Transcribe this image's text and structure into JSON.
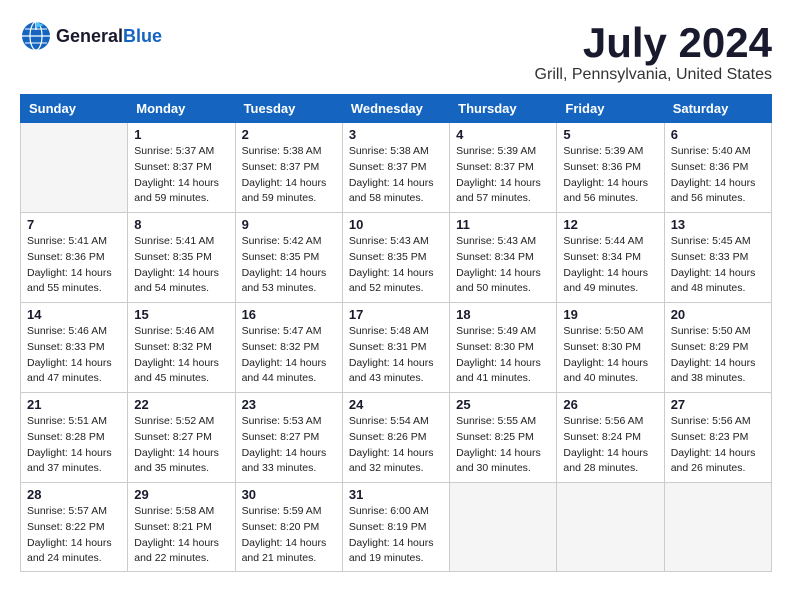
{
  "header": {
    "logo_general": "General",
    "logo_blue": "Blue",
    "month_year": "July 2024",
    "location": "Grill, Pennsylvania, United States"
  },
  "days_of_week": [
    "Sunday",
    "Monday",
    "Tuesday",
    "Wednesday",
    "Thursday",
    "Friday",
    "Saturday"
  ],
  "weeks": [
    [
      {
        "day": "",
        "info": ""
      },
      {
        "day": "1",
        "info": "Sunrise: 5:37 AM\nSunset: 8:37 PM\nDaylight: 14 hours\nand 59 minutes."
      },
      {
        "day": "2",
        "info": "Sunrise: 5:38 AM\nSunset: 8:37 PM\nDaylight: 14 hours\nand 59 minutes."
      },
      {
        "day": "3",
        "info": "Sunrise: 5:38 AM\nSunset: 8:37 PM\nDaylight: 14 hours\nand 58 minutes."
      },
      {
        "day": "4",
        "info": "Sunrise: 5:39 AM\nSunset: 8:37 PM\nDaylight: 14 hours\nand 57 minutes."
      },
      {
        "day": "5",
        "info": "Sunrise: 5:39 AM\nSunset: 8:36 PM\nDaylight: 14 hours\nand 56 minutes."
      },
      {
        "day": "6",
        "info": "Sunrise: 5:40 AM\nSunset: 8:36 PM\nDaylight: 14 hours\nand 56 minutes."
      }
    ],
    [
      {
        "day": "7",
        "info": "Sunrise: 5:41 AM\nSunset: 8:36 PM\nDaylight: 14 hours\nand 55 minutes."
      },
      {
        "day": "8",
        "info": "Sunrise: 5:41 AM\nSunset: 8:35 PM\nDaylight: 14 hours\nand 54 minutes."
      },
      {
        "day": "9",
        "info": "Sunrise: 5:42 AM\nSunset: 8:35 PM\nDaylight: 14 hours\nand 53 minutes."
      },
      {
        "day": "10",
        "info": "Sunrise: 5:43 AM\nSunset: 8:35 PM\nDaylight: 14 hours\nand 52 minutes."
      },
      {
        "day": "11",
        "info": "Sunrise: 5:43 AM\nSunset: 8:34 PM\nDaylight: 14 hours\nand 50 minutes."
      },
      {
        "day": "12",
        "info": "Sunrise: 5:44 AM\nSunset: 8:34 PM\nDaylight: 14 hours\nand 49 minutes."
      },
      {
        "day": "13",
        "info": "Sunrise: 5:45 AM\nSunset: 8:33 PM\nDaylight: 14 hours\nand 48 minutes."
      }
    ],
    [
      {
        "day": "14",
        "info": "Sunrise: 5:46 AM\nSunset: 8:33 PM\nDaylight: 14 hours\nand 47 minutes."
      },
      {
        "day": "15",
        "info": "Sunrise: 5:46 AM\nSunset: 8:32 PM\nDaylight: 14 hours\nand 45 minutes."
      },
      {
        "day": "16",
        "info": "Sunrise: 5:47 AM\nSunset: 8:32 PM\nDaylight: 14 hours\nand 44 minutes."
      },
      {
        "day": "17",
        "info": "Sunrise: 5:48 AM\nSunset: 8:31 PM\nDaylight: 14 hours\nand 43 minutes."
      },
      {
        "day": "18",
        "info": "Sunrise: 5:49 AM\nSunset: 8:30 PM\nDaylight: 14 hours\nand 41 minutes."
      },
      {
        "day": "19",
        "info": "Sunrise: 5:50 AM\nSunset: 8:30 PM\nDaylight: 14 hours\nand 40 minutes."
      },
      {
        "day": "20",
        "info": "Sunrise: 5:50 AM\nSunset: 8:29 PM\nDaylight: 14 hours\nand 38 minutes."
      }
    ],
    [
      {
        "day": "21",
        "info": "Sunrise: 5:51 AM\nSunset: 8:28 PM\nDaylight: 14 hours\nand 37 minutes."
      },
      {
        "day": "22",
        "info": "Sunrise: 5:52 AM\nSunset: 8:27 PM\nDaylight: 14 hours\nand 35 minutes."
      },
      {
        "day": "23",
        "info": "Sunrise: 5:53 AM\nSunset: 8:27 PM\nDaylight: 14 hours\nand 33 minutes."
      },
      {
        "day": "24",
        "info": "Sunrise: 5:54 AM\nSunset: 8:26 PM\nDaylight: 14 hours\nand 32 minutes."
      },
      {
        "day": "25",
        "info": "Sunrise: 5:55 AM\nSunset: 8:25 PM\nDaylight: 14 hours\nand 30 minutes."
      },
      {
        "day": "26",
        "info": "Sunrise: 5:56 AM\nSunset: 8:24 PM\nDaylight: 14 hours\nand 28 minutes."
      },
      {
        "day": "27",
        "info": "Sunrise: 5:56 AM\nSunset: 8:23 PM\nDaylight: 14 hours\nand 26 minutes."
      }
    ],
    [
      {
        "day": "28",
        "info": "Sunrise: 5:57 AM\nSunset: 8:22 PM\nDaylight: 14 hours\nand 24 minutes."
      },
      {
        "day": "29",
        "info": "Sunrise: 5:58 AM\nSunset: 8:21 PM\nDaylight: 14 hours\nand 22 minutes."
      },
      {
        "day": "30",
        "info": "Sunrise: 5:59 AM\nSunset: 8:20 PM\nDaylight: 14 hours\nand 21 minutes."
      },
      {
        "day": "31",
        "info": "Sunrise: 6:00 AM\nSunset: 8:19 PM\nDaylight: 14 hours\nand 19 minutes."
      },
      {
        "day": "",
        "info": ""
      },
      {
        "day": "",
        "info": ""
      },
      {
        "day": "",
        "info": ""
      }
    ]
  ]
}
